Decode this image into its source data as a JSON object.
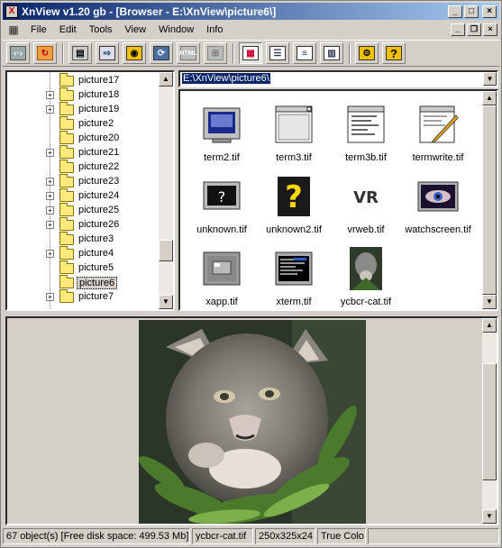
{
  "window": {
    "title": "XnView v1.20 gb - [Browser - E:\\XnView\\picture6\\]",
    "controls": [
      "_",
      "□",
      "×"
    ]
  },
  "menu": [
    "File",
    "Edit",
    "Tools",
    "View",
    "Window",
    "Info"
  ],
  "toolbar": {
    "buttons": [
      "back-icon",
      "refresh-icon",
      "print-icon",
      "scan-icon",
      "capture-icon",
      "convert-icon",
      "html-icon",
      "web-icon",
      "thumbnail-view-icon",
      "details-view-icon",
      "list-view-icon",
      "report-view-icon",
      "settings-icon",
      "help-icon"
    ],
    "html_label": "HTML",
    "help_label": "?"
  },
  "tree": {
    "items": [
      {
        "label": "picture17",
        "expandable": false
      },
      {
        "label": "picture18",
        "expandable": true
      },
      {
        "label": "picture19",
        "expandable": true
      },
      {
        "label": "picture2",
        "expandable": false
      },
      {
        "label": "picture20",
        "expandable": false
      },
      {
        "label": "picture21",
        "expandable": true
      },
      {
        "label": "picture22",
        "expandable": false
      },
      {
        "label": "picture23",
        "expandable": true
      },
      {
        "label": "picture24",
        "expandable": true
      },
      {
        "label": "picture25",
        "expandable": true
      },
      {
        "label": "picture26",
        "expandable": true
      },
      {
        "label": "picture3",
        "expandable": false
      },
      {
        "label": "picture4",
        "expandable": true
      },
      {
        "label": "picture5",
        "expandable": false
      },
      {
        "label": "picture6",
        "expandable": false,
        "selected": true
      },
      {
        "label": "picture7",
        "expandable": true
      }
    ]
  },
  "path": "E:\\XnView\\picture6\\",
  "files": [
    {
      "name": "term2.tif"
    },
    {
      "name": "term3.tif"
    },
    {
      "name": "term3b.tif"
    },
    {
      "name": "termwrite.tif"
    },
    {
      "name": "unknown.tif"
    },
    {
      "name": "unknown2.tif"
    },
    {
      "name": "vrweb.tif"
    },
    {
      "name": "watchscreen.tif"
    },
    {
      "name": "xapp.tif"
    },
    {
      "name": "xterm.tif"
    },
    {
      "name": "ycbcr-cat.tif"
    }
  ],
  "status": {
    "objects": "67 object(s) [Free disk space: 499.53 Mb]",
    "filename": "ycbcr-cat.tif",
    "dimensions": "250x325x24",
    "colors": "True Colo"
  },
  "colors": {
    "title_gradient_start": "#0a246a",
    "title_gradient_end": "#a6caf0",
    "face": "#d4d0c8",
    "selection": "#0a246a"
  }
}
